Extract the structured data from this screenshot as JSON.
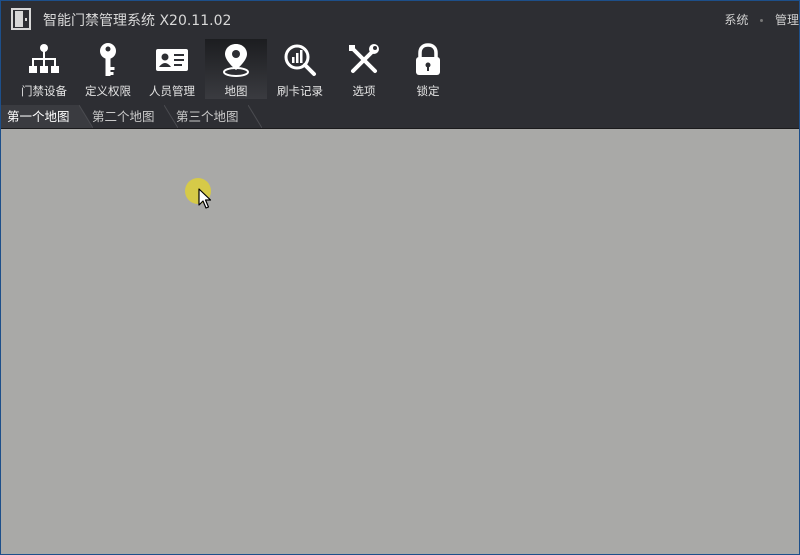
{
  "window": {
    "title": "智能门禁管理系统 X20.11.02",
    "logo_icon": "door-icon"
  },
  "top_menu": [
    {
      "label": "系统"
    },
    {
      "label": "管理"
    }
  ],
  "toolbar": {
    "items": [
      {
        "label": "门禁设备",
        "icon": "device-tree-icon"
      },
      {
        "label": "定义权限",
        "icon": "key-icon"
      },
      {
        "label": "人员管理",
        "icon": "id-card-icon"
      },
      {
        "label": "地图",
        "icon": "map-pin-icon",
        "active": true
      },
      {
        "label": "刷卡记录",
        "icon": "search-chart-icon"
      },
      {
        "label": "选项",
        "icon": "tools-icon"
      },
      {
        "label": "锁定",
        "icon": "lock-icon"
      }
    ]
  },
  "tabs": [
    {
      "label": "第一个地图",
      "active": true
    },
    {
      "label": "第二个地图"
    },
    {
      "label": "第三个地图"
    }
  ],
  "colors": {
    "chrome": "#2d2e33",
    "map_background": "#a9a9a7",
    "window_border": "#1d4f8a",
    "cursor_highlight": "#e6d628"
  }
}
